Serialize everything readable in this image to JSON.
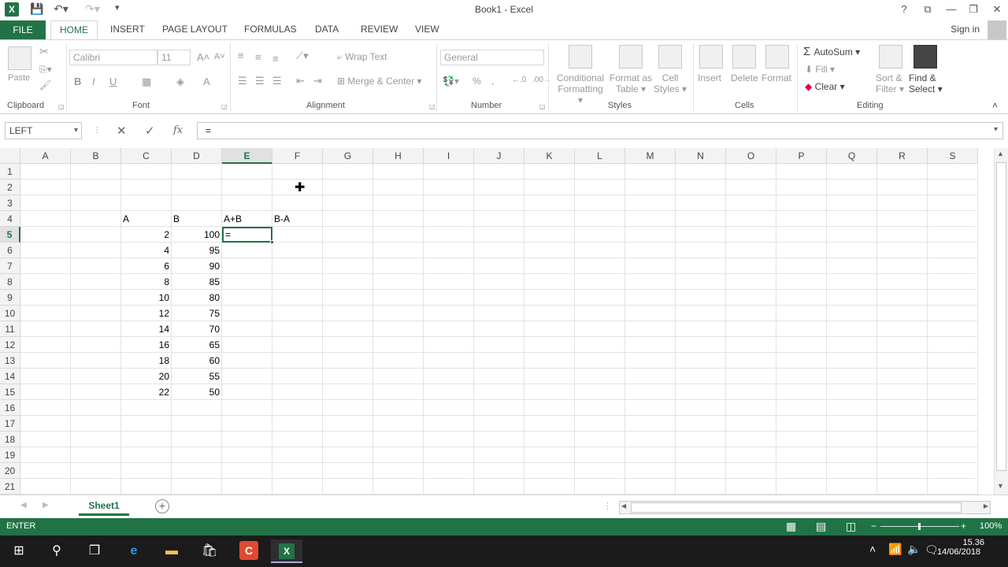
{
  "window": {
    "title": "Book1 - Excel"
  },
  "title_bar": {
    "icons": [
      "excel-logo",
      "save-icon",
      "undo-icon",
      "redo-icon",
      "customize-icon"
    ],
    "logo_text": "X",
    "controls": [
      "?",
      "⧉",
      "—",
      "❐",
      "✕"
    ]
  },
  "ribbon_tabs": {
    "file": "FILE",
    "home": "HOME",
    "insert": "INSERT",
    "page_layout": "PAGE LAYOUT",
    "formulas": "FORMULAS",
    "data": "DATA",
    "review": "REVIEW",
    "view": "VIEW",
    "sign_in": "Sign in"
  },
  "ribbon": {
    "clipboard": {
      "label": "Clipboard",
      "paste": "Paste"
    },
    "font": {
      "label": "Font",
      "name": "Calibri",
      "size": "11"
    },
    "alignment": {
      "label": "Alignment",
      "wrap_text": "Wrap Text",
      "merge_center": "Merge & Center"
    },
    "number": {
      "label": "Number",
      "format": "General"
    },
    "styles": {
      "label": "Styles",
      "conditional": "Conditional",
      "conditional2": "Formatting",
      "format_as": "Format as",
      "format_as2": "Table",
      "cell": "Cell",
      "cell2": "Styles"
    },
    "cells": {
      "label": "Cells",
      "insert": "Insert",
      "delete": "Delete",
      "format": "Format"
    },
    "editing": {
      "label": "Editing",
      "autosum": "AutoSum",
      "fill": "Fill",
      "clear": "Clear",
      "sort": "Sort &",
      "sort2": "Filter",
      "find": "Find &",
      "find2": "Select"
    }
  },
  "formula_bar": {
    "name_box": "LEFT",
    "fx": "fx",
    "formula": "="
  },
  "columns": [
    "A",
    "B",
    "C",
    "D",
    "E",
    "F",
    "G",
    "H",
    "I",
    "J",
    "K",
    "L",
    "M",
    "N",
    "O",
    "P",
    "Q",
    "R",
    "S"
  ],
  "rows": [
    "1",
    "2",
    "3",
    "4",
    "5",
    "6",
    "7",
    "8",
    "9",
    "10",
    "11",
    "12",
    "13",
    "14",
    "15",
    "16",
    "17",
    "18",
    "19",
    "20",
    "21"
  ],
  "selected": {
    "column": "E",
    "row": "5"
  },
  "cells": {
    "C4": "A",
    "D4": "B",
    "E4": "A+B",
    "F4": "B-A",
    "C5": "2",
    "D5": "100",
    "E5": "=",
    "C6": "4",
    "D6": "95",
    "C7": "6",
    "D7": "90",
    "C8": "8",
    "D8": "85",
    "C9": "10",
    "D9": "80",
    "C10": "12",
    "D10": "75",
    "C11": "14",
    "D11": "70",
    "C12": "16",
    "D12": "65",
    "C13": "18",
    "D13": "60",
    "C14": "20",
    "D14": "55",
    "C15": "22",
    "D15": "50"
  },
  "sheets": {
    "active": "Sheet1"
  },
  "status_bar": {
    "mode": "ENTER",
    "zoom": "100%"
  },
  "taskbar": {
    "time": "15.36",
    "date": "14/06/2018"
  },
  "colors": {
    "accent": "#217346",
    "taskbar": "#1b1b1b"
  }
}
